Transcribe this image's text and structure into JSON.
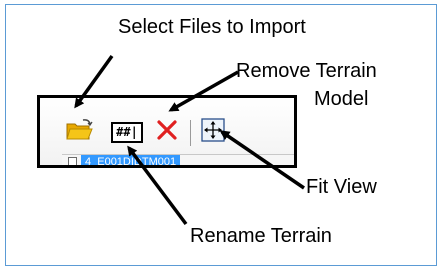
{
  "callouts": {
    "select_files": "Select Files to Import",
    "remove_terrain_line1": "Remove Terrain",
    "remove_terrain_line2": "Model",
    "fit_view": "Fit View",
    "rename_terrain": "Rename Terrain"
  },
  "toolbar": {
    "icons": [
      "folder-open-icon",
      "rename-icon",
      "delete-x-icon",
      "fit-view-icon"
    ],
    "rename_glyph": "##|",
    "tree_item_label": "4_E001DIDTM001"
  },
  "colors": {
    "frame_border": "#5b9bd5",
    "folder_yellow": "#f5c518",
    "delete_red": "#e02020",
    "selection_blue": "#3399ff"
  }
}
